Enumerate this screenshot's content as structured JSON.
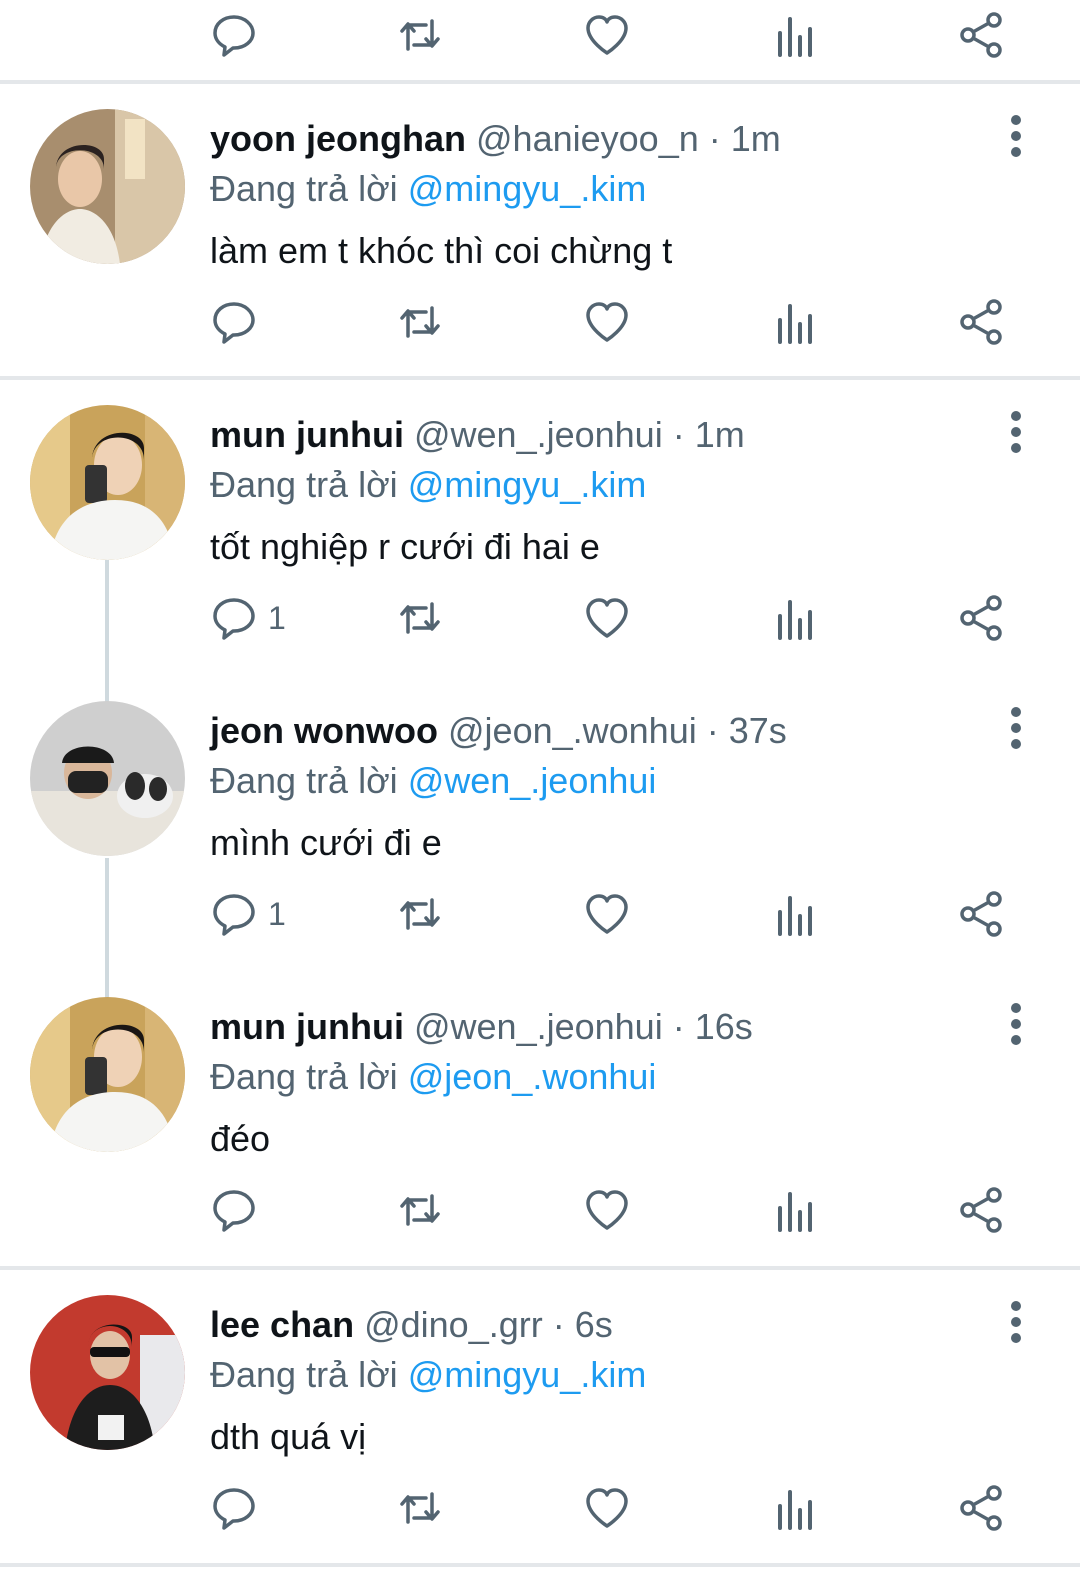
{
  "reply_prefix": "Đang trả lời",
  "colors": {
    "mention": "#1d9bf0",
    "text": "#0f1419",
    "muted": "#536471"
  },
  "icons": [
    "reply-icon",
    "retweet-icon",
    "like-icon",
    "views-icon",
    "share-icon",
    "more-icon"
  ],
  "tweets": [
    {
      "name": "yoon jeonghan",
      "handle": "@hanieyoo_n",
      "time": "· 1m",
      "reply_to": "@mingyu_.kim",
      "text": "làm em t khóc thì coi chừng t",
      "reply_count": ""
    },
    {
      "name": "mun junhui",
      "handle": "@wen_.jeonhui",
      "time": "· 1m",
      "reply_to": "@mingyu_.kim",
      "text": "tốt nghiệp r cưới đi hai e",
      "reply_count": "1"
    },
    {
      "name": "jeon wonwoo",
      "handle": "@jeon_.wonhui",
      "time": "· 37s",
      "reply_to": "@wen_.jeonhui",
      "text": "mình cưới đi e",
      "reply_count": "1"
    },
    {
      "name": "mun junhui",
      "handle": "@wen_.jeonhui",
      "time": "· 16s",
      "reply_to": "@jeon_.wonhui",
      "text": "đéo",
      "reply_count": ""
    },
    {
      "name": "lee chan",
      "handle": "@dino_.grr",
      "time": "· 6s",
      "reply_to": "@mingyu_.kim",
      "text": "dth quá vị",
      "reply_count": ""
    }
  ]
}
